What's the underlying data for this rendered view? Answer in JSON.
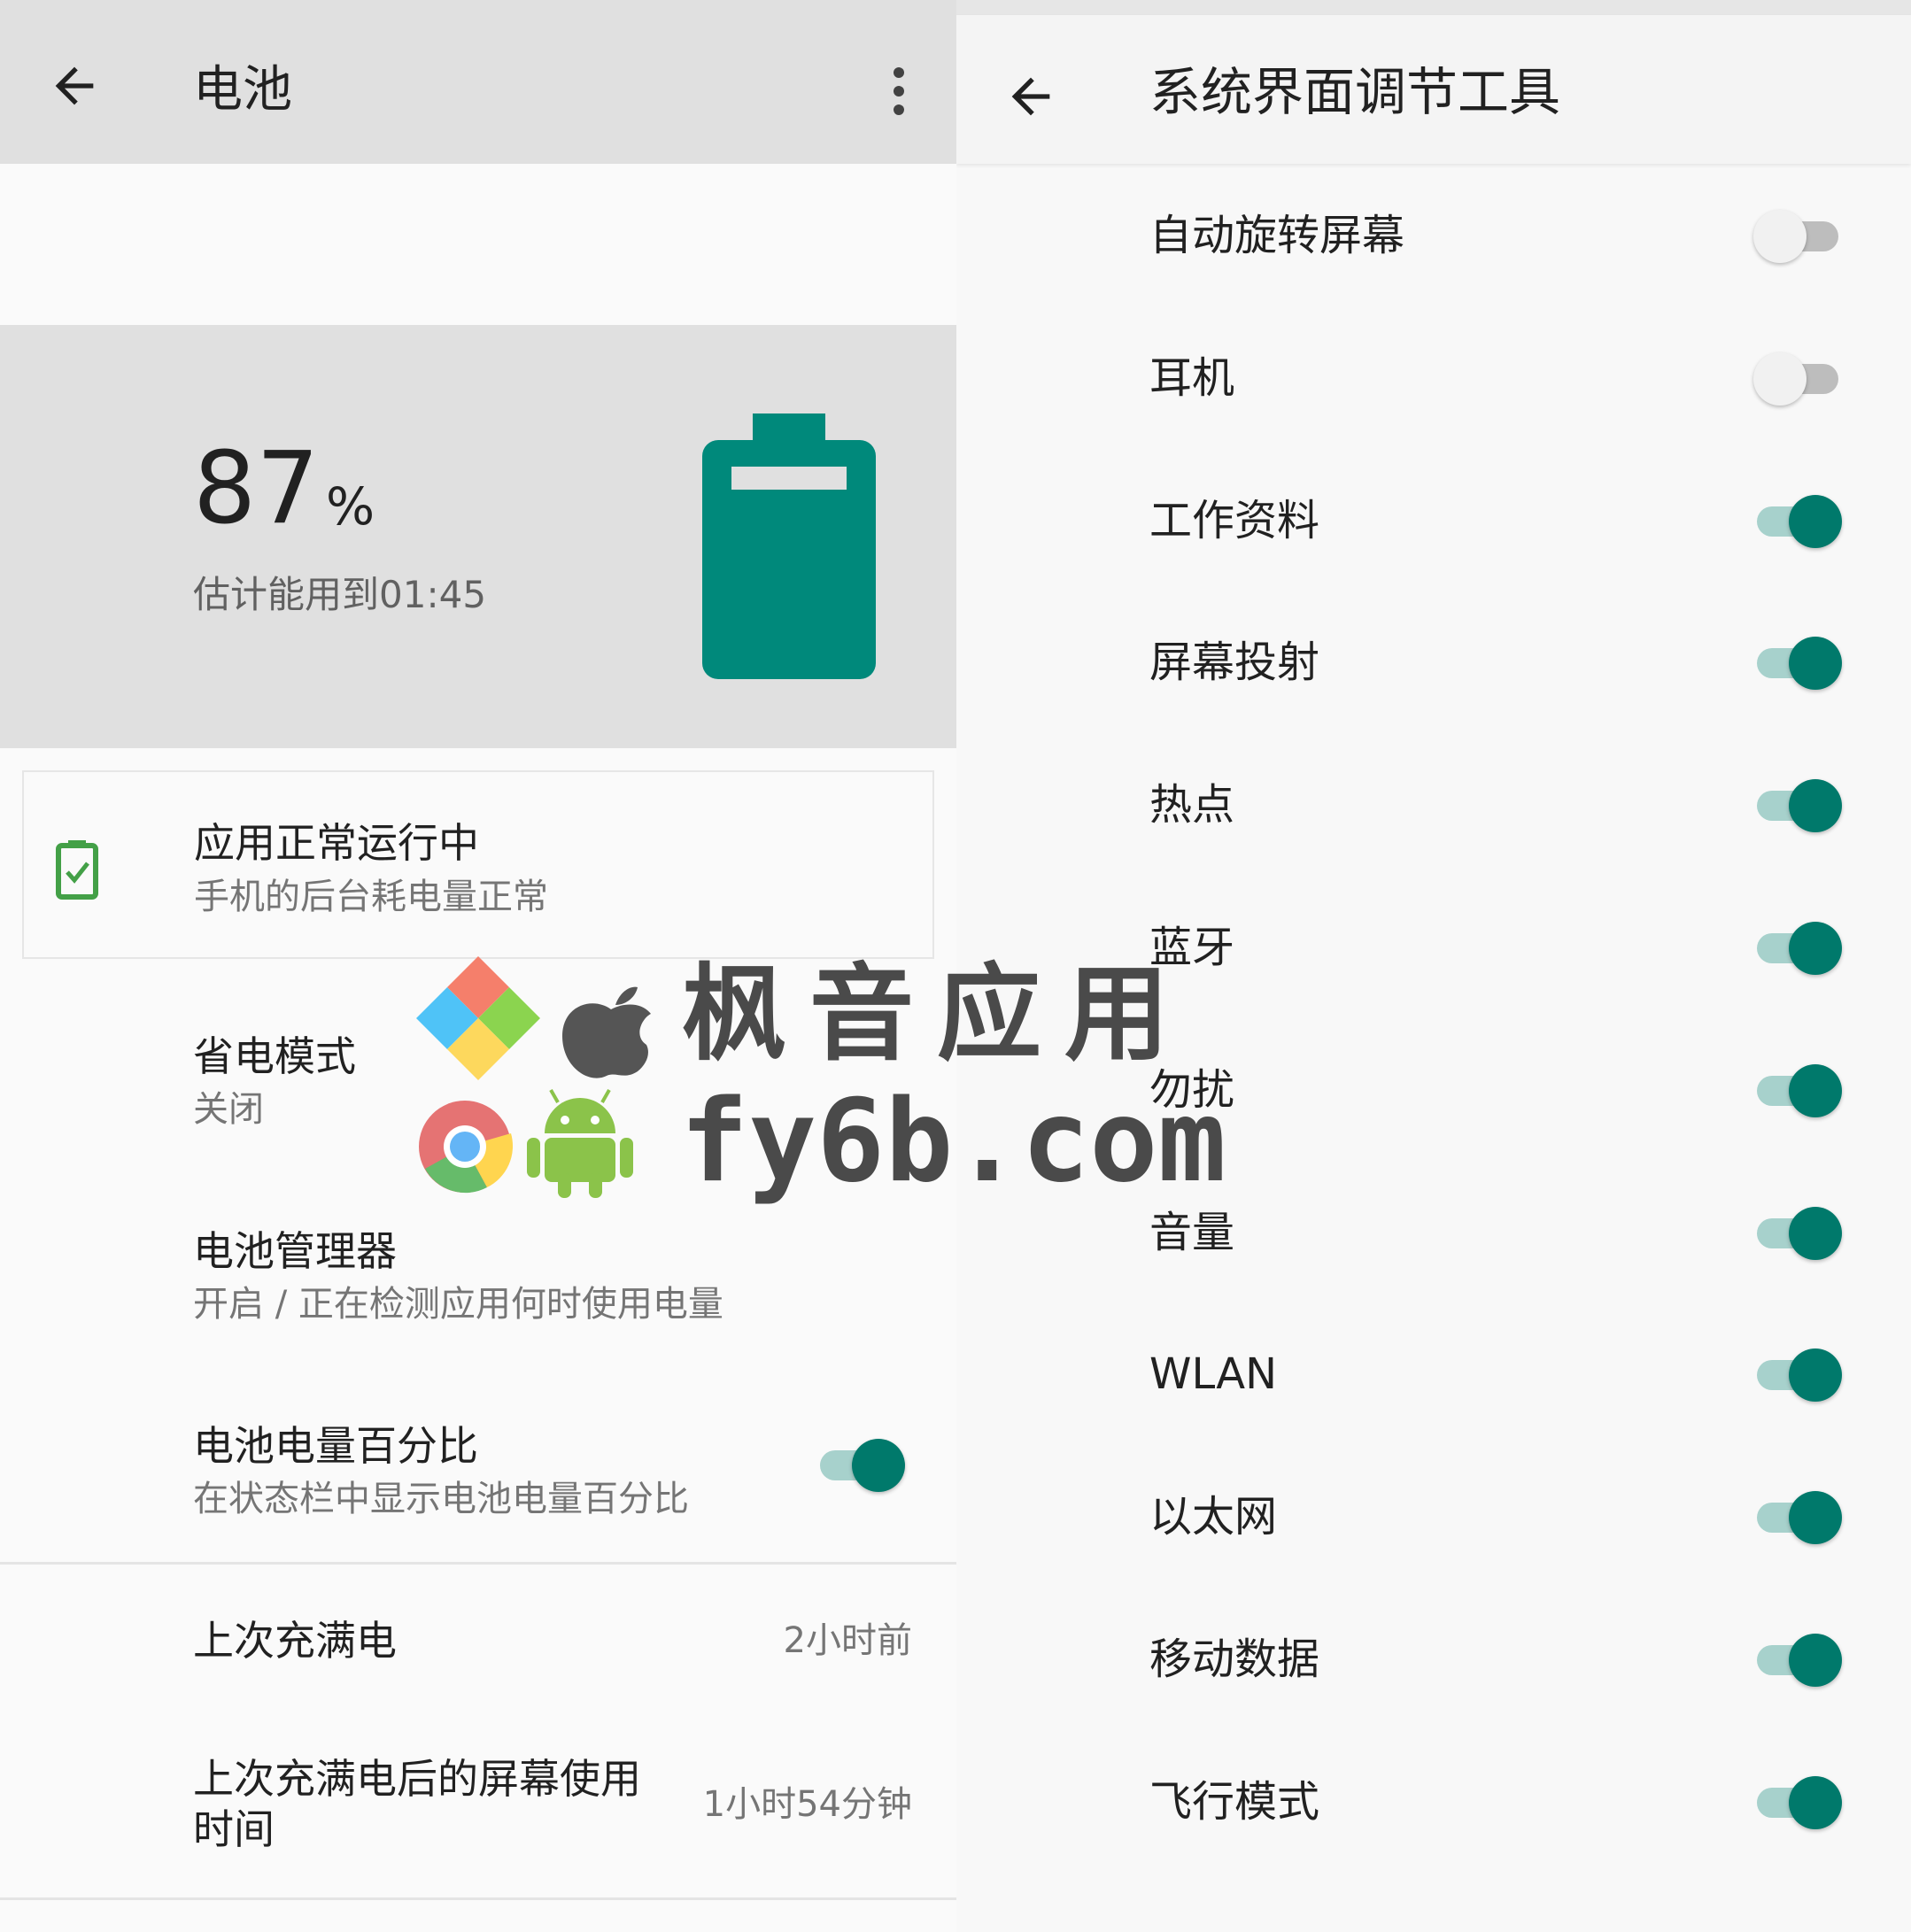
{
  "battery": {
    "toolbar": {
      "title": "电池"
    },
    "level": {
      "percent_value": "87",
      "percent_sign": "%",
      "estimate": "估计能用到01:45",
      "color": "#00897b"
    },
    "tip": {
      "title": "应用正常运行中",
      "subtitle": "手机的后台耗电量正常",
      "icon": "battery-check-icon",
      "icon_color": "#43a047"
    },
    "prefs": [
      {
        "title": "省电模式",
        "subtitle": "关闭"
      },
      {
        "title": "电池管理器",
        "subtitle": "开启 / 正在检测应用何时使用电量"
      },
      {
        "title": "电池电量百分比",
        "subtitle": "在状态栏中显示电池电量百分比",
        "switch_on": true
      }
    ],
    "info": [
      {
        "title": "上次充满电",
        "value": "2小时前"
      },
      {
        "title_line1": "上次充满电后的屏幕使用",
        "title_line2": "时间",
        "value": "1小时54分钟"
      }
    ]
  },
  "tuner": {
    "toolbar": {
      "title": "系统界面调节工具"
    },
    "items": [
      {
        "label": "自动旋转屏幕",
        "on": false
      },
      {
        "label": "耳机",
        "on": false
      },
      {
        "label": "工作资料",
        "on": true
      },
      {
        "label": "屏幕投射",
        "on": true
      },
      {
        "label": "热点",
        "on": true
      },
      {
        "label": "蓝牙",
        "on": true
      },
      {
        "label": "勿扰",
        "on": true
      },
      {
        "label": "音量",
        "on": true
      },
      {
        "label": "WLAN",
        "on": true
      },
      {
        "label": "以太网",
        "on": true
      },
      {
        "label": "移动数据",
        "on": true
      },
      {
        "label": "飞行模式",
        "on": true
      }
    ]
  },
  "watermark": {
    "line1": "枫音应用",
    "line2": "fy6b.com"
  },
  "colors": {
    "accent": "#00796b",
    "switch_track_on": "#a7d1cc",
    "header_bg": "#e0e0e0"
  }
}
